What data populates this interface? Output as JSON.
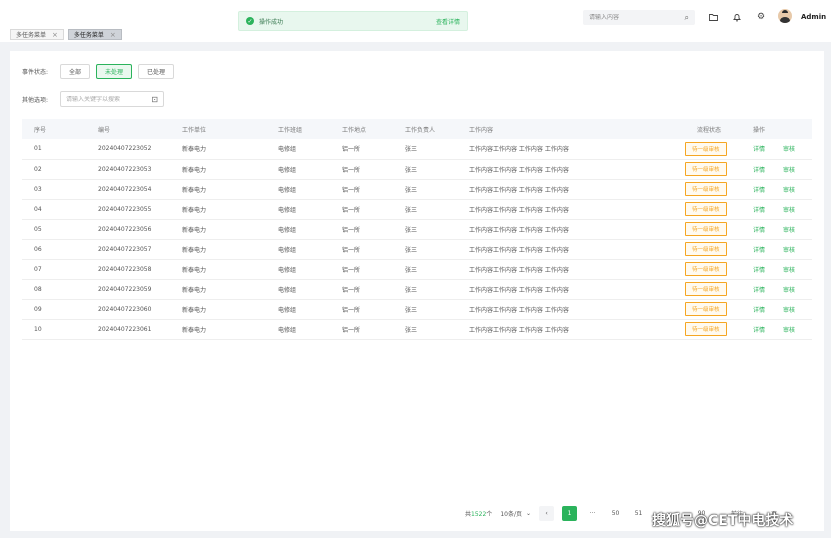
{
  "tabs": [
    {
      "label": "多任务菜单",
      "close": "×",
      "active": false
    },
    {
      "label": "多任务菜单",
      "close": "×",
      "active": true
    }
  ],
  "toast": {
    "icon": "check-circle-icon",
    "message": "操作成功",
    "link": "查看详情"
  },
  "header": {
    "search_placeholder": "请输入内容",
    "user": "Admin"
  },
  "filters": {
    "status_label": "事件状态:",
    "status_options": [
      "全部",
      "未处理",
      "已处理"
    ],
    "status_selected": "未处理",
    "other_label": "其他选项:",
    "keyword_placeholder": "请输入关键字以搜索"
  },
  "table": {
    "columns": [
      "序号",
      "编号",
      "工作单位",
      "工作班组",
      "工作地点",
      "工作负责人",
      "工作内容",
      "流程状态",
      "操作"
    ],
    "rows": [
      {
        "idx": "01",
        "code": "20240407223052",
        "unit": "新泰电力",
        "team": "电修组",
        "place": "铝一所",
        "leader": "张三",
        "content": "工作内容工作内容 工作内容 工作内容",
        "status": "待一级审核",
        "action1": "详情",
        "action2": "审核"
      },
      {
        "idx": "02",
        "code": "20240407223053",
        "unit": "新泰电力",
        "team": "电修组",
        "place": "铝一所",
        "leader": "张三",
        "content": "工作内容工作内容 工作内容 工作内容",
        "status": "待一级审核",
        "action1": "详情",
        "action2": "审核"
      },
      {
        "idx": "03",
        "code": "20240407223054",
        "unit": "新泰电力",
        "team": "电修组",
        "place": "铝一所",
        "leader": "张三",
        "content": "工作内容工作内容 工作内容 工作内容",
        "status": "待一级审核",
        "action1": "详情",
        "action2": "审核"
      },
      {
        "idx": "04",
        "code": "20240407223055",
        "unit": "新泰电力",
        "team": "电修组",
        "place": "铝一所",
        "leader": "张三",
        "content": "工作内容工作内容 工作内容 工作内容",
        "status": "待一级审核",
        "action1": "详情",
        "action2": "审核"
      },
      {
        "idx": "05",
        "code": "20240407223056",
        "unit": "新泰电力",
        "team": "电修组",
        "place": "铝一所",
        "leader": "张三",
        "content": "工作内容工作内容 工作内容 工作内容",
        "status": "待一级审核",
        "action1": "详情",
        "action2": "审核"
      },
      {
        "idx": "06",
        "code": "20240407223057",
        "unit": "新泰电力",
        "team": "电修组",
        "place": "铝一所",
        "leader": "张三",
        "content": "工作内容工作内容 工作内容 工作内容",
        "status": "待一级审核",
        "action1": "详情",
        "action2": "审核"
      },
      {
        "idx": "07",
        "code": "20240407223058",
        "unit": "新泰电力",
        "team": "电修组",
        "place": "铝一所",
        "leader": "张三",
        "content": "工作内容工作内容 工作内容 工作内容",
        "status": "待一级审核",
        "action1": "详情",
        "action2": "审核"
      },
      {
        "idx": "08",
        "code": "20240407223059",
        "unit": "新泰电力",
        "team": "电修组",
        "place": "铝一所",
        "leader": "张三",
        "content": "工作内容工作内容 工作内容 工作内容",
        "status": "待一级审核",
        "action1": "详情",
        "action2": "审核"
      },
      {
        "idx": "09",
        "code": "20240407223060",
        "unit": "新泰电力",
        "team": "电修组",
        "place": "铝一所",
        "leader": "张三",
        "content": "工作内容工作内容 工作内容 工作内容",
        "status": "待一级审核",
        "action1": "详情",
        "action2": "审核"
      },
      {
        "idx": "10",
        "code": "20240407223061",
        "unit": "新泰电力",
        "team": "电修组",
        "place": "铝一所",
        "leader": "张三",
        "content": "工作内容工作内容 工作内容 工作内容",
        "status": "待一级审核",
        "action1": "详情",
        "action2": "审核"
      }
    ]
  },
  "pagination": {
    "total_prefix": "共",
    "total": "1522",
    "total_suffix": "个",
    "page_size": "10条/页",
    "prev": "‹",
    "pages": [
      "1",
      "···",
      "50",
      "51"
    ],
    "current": "1",
    "hidden_tail": "90",
    "goto_label": "前往",
    "goto_suffix": "页"
  },
  "watermark": "搜狐号@CET中电技术",
  "colors": {
    "accent": "#2bb35c",
    "warning": "#f5a623"
  }
}
